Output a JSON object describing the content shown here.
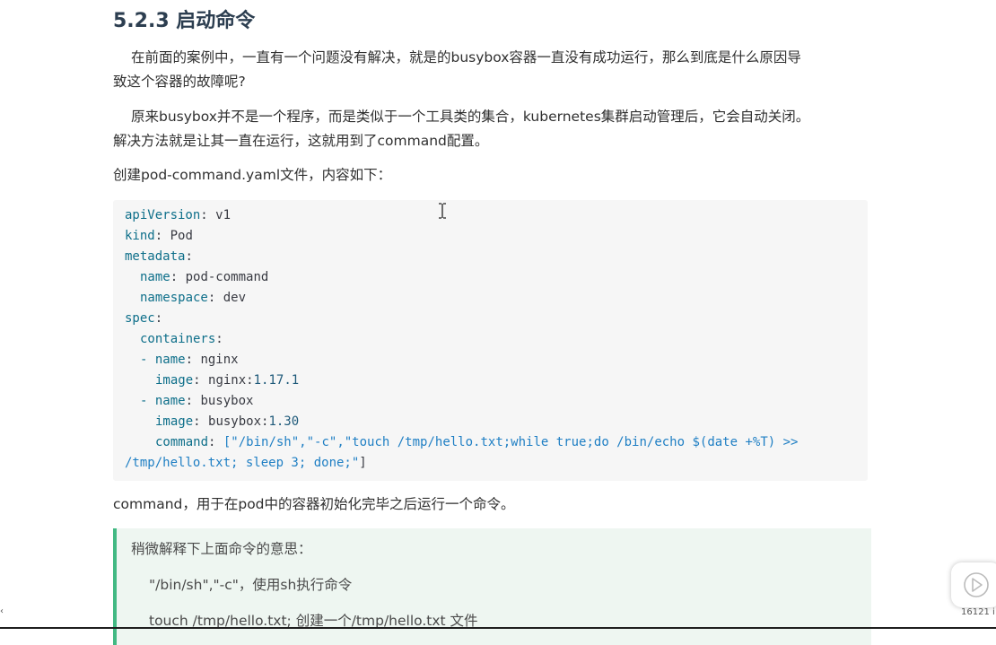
{
  "heading": "5.2.3 启动命令",
  "paragraphs": {
    "p1_line1": "在前面的案例中，一直有一个问题没有解决，就是的busybox容器一直没有成功运行，那么到底是什么原因导",
    "p1_line2": "致这个容器的故障呢?",
    "p2_line1": "原来busybox并不是一个程序，而是类似于一个工具类的集合，kubernetes集群启动管理后，它会自动关闭。",
    "p2_line2": "解决方法就是让其一直在运行，这就用到了command配置。",
    "p3": "创建pod-command.yaml文件，内容如下：",
    "p4": "command，用于在pod中的容器初始化完毕之后运行一个命令。"
  },
  "code": {
    "l1_key": "apiVersion",
    "l1_val": " v1",
    "l2_key": "kind",
    "l2_val": " Pod",
    "l3_key": "metadata",
    "l4_key": "name",
    "l4_val": " pod-command",
    "l5_key": "namespace",
    "l5_val": " dev",
    "l6_key": "spec",
    "l7_key": "containers",
    "l8_dash": "- ",
    "l8_key": "name",
    "l8_val": " nginx",
    "l9_key": "image",
    "l9_val": " nginx:",
    "l9_num": "1.17.1",
    "l10_dash": "- ",
    "l10_key": "name",
    "l10_val": " busybox",
    "l11_key": "image",
    "l11_val": " busybox:",
    "l11_num": "1.30",
    "l12_key": "command",
    "l12_val": " [\"/bin/sh\",\"-c\",\"touch /tmp/hello.txt;while true;do /bin/echo $(date +%T) >>",
    "l13_val": "/tmp/hello.txt; sleep 3; done;\"",
    "l13_end": "]",
    "colon": ":"
  },
  "blockquote": {
    "line1": "稍微解释下上面命令的意思：",
    "line2": "\"/bin/sh\",\"-c\"，使用sh执行命令",
    "line3": "touch /tmp/hello.txt;   创建一个/tmp/hello.txt 文件"
  },
  "player": {
    "count": "16121 i"
  },
  "colors": {
    "code_key": "#0e6f8a",
    "code_string": "#1f7fc4",
    "quote_border": "#42b983",
    "quote_bg": "#eef6f1",
    "code_bg": "#f6f6f6"
  },
  "icons": {
    "cursor": "text-cursor-icon",
    "play": "play-icon",
    "left_arrow": "arrow-left-icon"
  }
}
